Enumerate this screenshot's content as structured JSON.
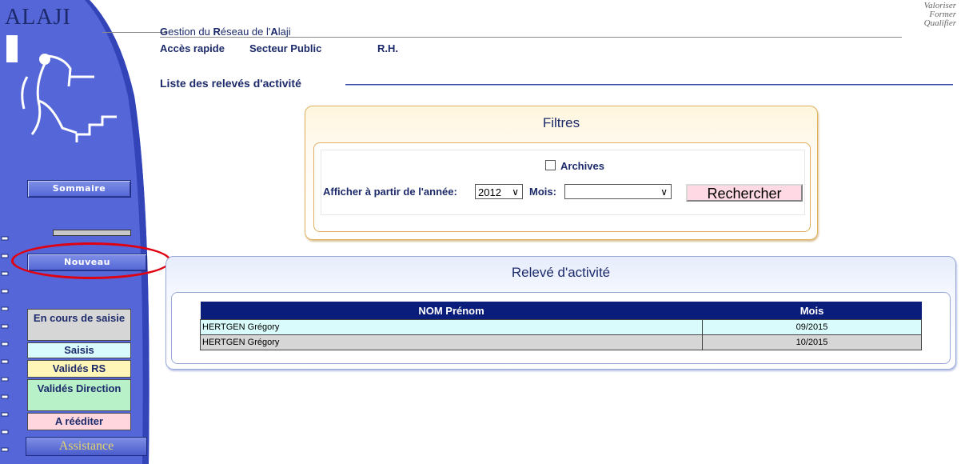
{
  "logo": "ALAJI",
  "tagline": [
    "Valoriser",
    "Former",
    "Qualifier"
  ],
  "header": {
    "title_parts": [
      "G",
      "estion du ",
      "R",
      "éseau de l'",
      "A",
      "laji"
    ],
    "nav": [
      "Accès rapide",
      "Secteur Public",
      "R.H."
    ]
  },
  "section_title": "Liste des relevés d'activité",
  "sidebar": {
    "sommaire": "Sommaire",
    "nouveau": "Nouveau",
    "status": [
      {
        "label": "En cours de saisie",
        "color": "#d6d6d6"
      },
      {
        "label": "Saisis",
        "color": "#d9fbfb"
      },
      {
        "label": "Validés RS",
        "color": "#fff6b8"
      },
      {
        "label": "Validés Direction",
        "color": "#b8f0c8"
      },
      {
        "label": "A rééditer",
        "color": "#ffd6de"
      }
    ],
    "assistance": "Assistance"
  },
  "filters": {
    "title": "Filtres",
    "archives_label": "Archives",
    "year_label": "Afficher à partir de l'année:",
    "year_value": "2012",
    "month_label": "Mois:",
    "month_value": "",
    "search_button": "Rechercher"
  },
  "activity": {
    "title": "Relevé d'activité",
    "columns": [
      "NOM Prénom",
      "Mois"
    ],
    "rows": [
      {
        "name": "HERTGEN Grégory",
        "month": "09/2015"
      },
      {
        "name": "HERTGEN Grégory",
        "month": "10/2015"
      }
    ]
  }
}
